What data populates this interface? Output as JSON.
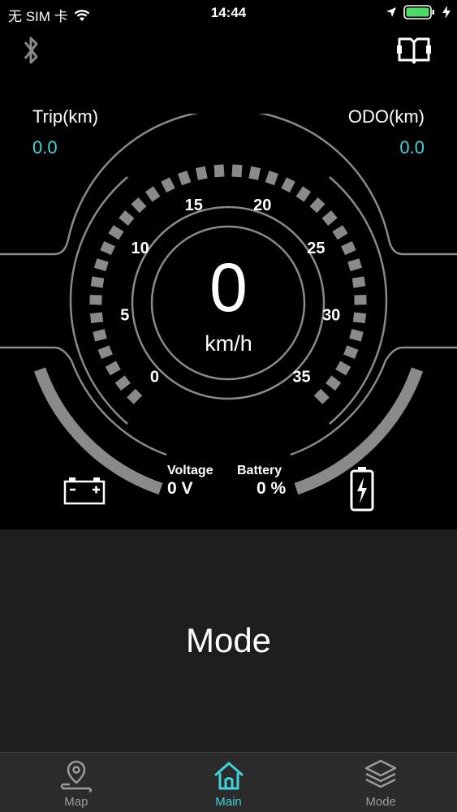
{
  "status_bar": {
    "carrier": "无 SIM 卡",
    "time": "14:44"
  },
  "trip": {
    "label": "Trip(km)",
    "value": "0.0"
  },
  "odo": {
    "label": "ODO(km)",
    "value": "0.0"
  },
  "gauge": {
    "tick_labels": [
      "0",
      "5",
      "10",
      "15",
      "20",
      "25",
      "30",
      "35"
    ],
    "speed_value": "0",
    "speed_unit": "km/h",
    "speed_fraction": 0
  },
  "voltage": {
    "label": "Voltage",
    "value": "0 V"
  },
  "battery": {
    "label": "Battery",
    "value": "0 %"
  },
  "mode": {
    "label": "Mode"
  },
  "tabs": [
    {
      "label": "Map",
      "icon": "map-pin-icon",
      "active": false
    },
    {
      "label": "Main",
      "icon": "home-icon",
      "active": true
    },
    {
      "label": "Mode",
      "icon": "layers-icon",
      "active": false
    }
  ],
  "colors": {
    "accent": "#3fd3da",
    "gauge_gray": "#8a8a8a",
    "panel": "#1e1e1f",
    "tab_bar": "#2b2b2c"
  }
}
